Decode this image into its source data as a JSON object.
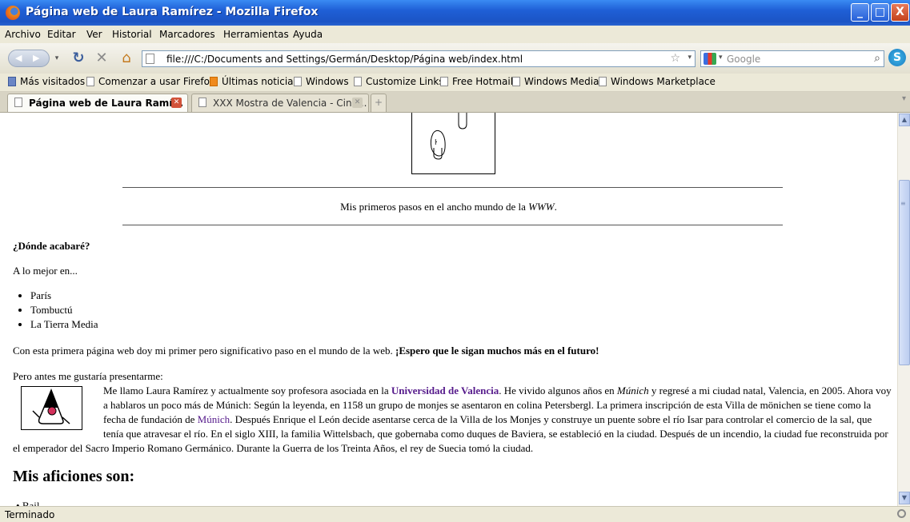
{
  "window": {
    "title": "Página web de Laura Ramírez - Mozilla Firefox",
    "min_label": "_",
    "max_label": "□",
    "close_label": "X"
  },
  "menu": [
    "Archivo",
    "Editar",
    "Ver",
    "Historial",
    "Marcadores",
    "Herramientas",
    "Ayuda"
  ],
  "toolbar": {
    "url": "file:///C:/Documents and Settings/Germán/Desktop/Página web/index.html",
    "search_placeholder": "Google"
  },
  "bookmarks": [
    "Más visitados",
    "Comenzar a usar Firefox",
    "Últimas noticias",
    "Windows",
    "Customize Links",
    "Free Hotmail",
    "Windows Media",
    "Windows Marketplace"
  ],
  "tabs": [
    {
      "label": "Página web de Laura Ramí...",
      "active": true
    },
    {
      "label": "XXX Mostra de Valencia - Cine...",
      "active": false
    }
  ],
  "page": {
    "caption_prefix": "Mis primeros pasos en el ancho mundo de la ",
    "caption_em": "WWW",
    "caption_suffix": ".",
    "heading_where": "¿Dónde acabaré?",
    "maybe": "A lo mejor en...",
    "places": [
      "París",
      "Tombuctú",
      "La Tierra Media"
    ],
    "first_step": "Con esta primera página web doy mi primer pero significativo paso en el mundo de la web. ",
    "first_step_bold": "¡Espero que le sigan muchos más en el futuro!",
    "before": "Pero antes me gustaría presentarme:",
    "bio_1": "Me llamo Laura Ramírez y actualmente soy profesora asociada en la ",
    "bio_link_uv": "Universidad de Valencia",
    "bio_2": ". He vivido algunos años en ",
    "bio_em_munich": "Múnich",
    "bio_3": " y regresé a mi ciudad natal, Valencia, en 2005. Ahora voy a hablaros un poco más de Múnich: Según la leyenda, en 1158 un grupo de monjes se asentaron en colina Petersbergl. La primera inscripción de esta Villa de mönichen se tiene como la fecha de fundación de ",
    "bio_link_munich": "Múnich",
    "bio_4": ". Después Enrique el León decide asentarse cerca de la Villa de los Monjes y construye un puente sobre el río Isar para controlar el comercio de la sal, que tenía que atravesar el río. En el siglo XIII, la familia Wittelsbach, que gobernaba como duques de Baviera, se estableció en la ciudad. Después de un incendio, la ciudad fue reconstruida por el emperador del Sacro Imperio Romano Germánico. Durante la Guerra de los Treinta Años, el rey de Suecia tomó la ciudad.",
    "hobbies_heading": "Mis aficiones son:",
    "hobby_cut": "Bail"
  },
  "status": "Terminado"
}
